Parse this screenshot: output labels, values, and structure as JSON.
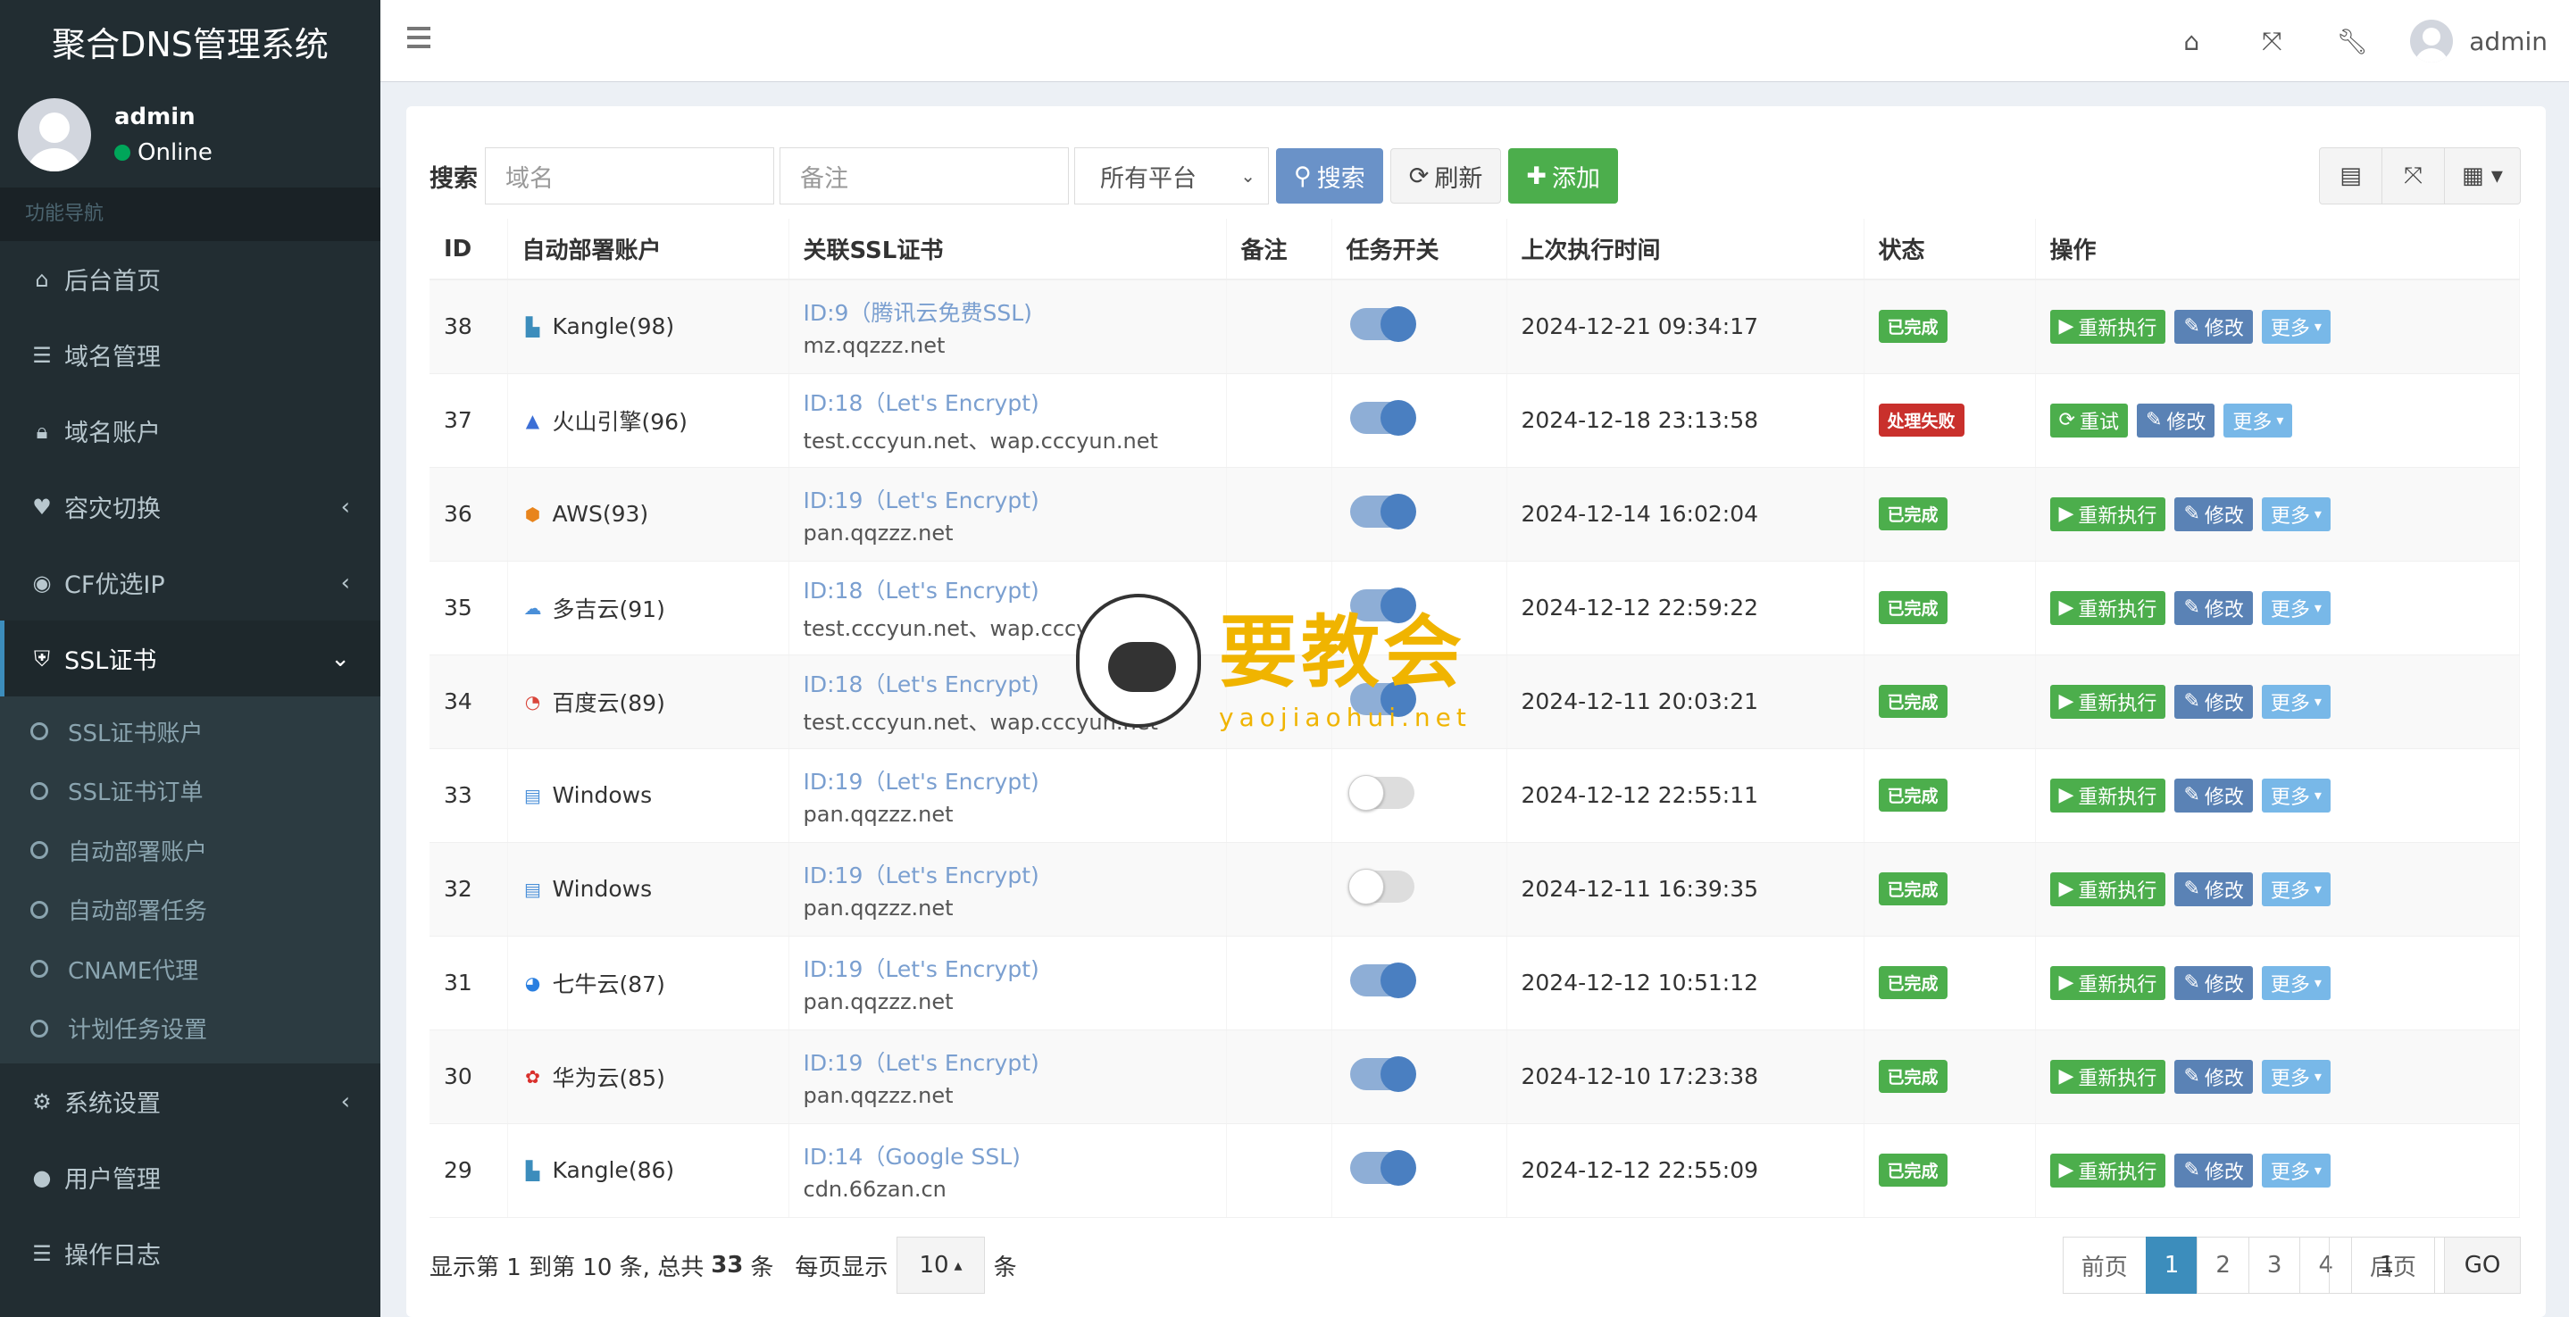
{
  "app": {
    "title": "聚合DNS管理系统"
  },
  "user": {
    "name": "admin",
    "status": "Online"
  },
  "nav": {
    "header": "功能导航",
    "items": [
      {
        "label": "后台首页",
        "icon": "home-icon"
      },
      {
        "label": "域名管理",
        "icon": "list-icon"
      },
      {
        "label": "域名账户",
        "icon": "lock-icon"
      },
      {
        "label": "容灾切换",
        "icon": "heartbeat-icon"
      },
      {
        "label": "CF优选IP",
        "icon": "globe-icon"
      },
      {
        "label": "SSL证书",
        "icon": "certificate-icon"
      }
    ],
    "sub_items": [
      "SSL证书账户",
      "SSL证书订单",
      "自动部署账户",
      "自动部署任务",
      "CNAME代理",
      "计划任务设置"
    ],
    "bottom_items": [
      {
        "label": "系统设置",
        "icon": "cogs-icon"
      },
      {
        "label": "用户管理",
        "icon": "user-icon"
      },
      {
        "label": "操作日志",
        "icon": "list-icon"
      }
    ]
  },
  "header": {
    "admin_label": "admin"
  },
  "toolbar": {
    "search_label": "搜索",
    "domain_placeholder": "域名",
    "remark_placeholder": "备注",
    "platform_selected": "所有平台",
    "search_button": "搜索",
    "refresh_button": "刷新",
    "add_button": "添加"
  },
  "table": {
    "columns": [
      "ID",
      "自动部署账户",
      "关联SSL证书",
      "备注",
      "任务开关",
      "上次执行时间",
      "状态",
      "操作"
    ],
    "rows": [
      {
        "id": "38",
        "account": "Kangle(98)",
        "icon": "kangle-icon",
        "cert": "ID:9（腾讯云免费SSL)",
        "domains": "mz.qqzzz.net",
        "enabled": true,
        "time": "2024-12-21 09:34:17",
        "status": "已完成",
        "ok": true,
        "op1": "重新执行",
        "op2": "修改",
        "op3": "更多"
      },
      {
        "id": "37",
        "account": "火山引擎(96)",
        "icon": "volcengine-icon",
        "cert": "ID:18（Let's Encrypt)",
        "domains": "test.cccyun.net、wap.cccyun.net",
        "enabled": true,
        "time": "2024-12-18 23:13:58",
        "status": "处理失败",
        "ok": false,
        "op1": "重试",
        "op2": "修改",
        "op3": "更多"
      },
      {
        "id": "36",
        "account": "AWS(93)",
        "icon": "aws-icon",
        "cert": "ID:19（Let's Encrypt)",
        "domains": "pan.qqzzz.net",
        "enabled": true,
        "time": "2024-12-14 16:02:04",
        "status": "已完成",
        "ok": true,
        "op1": "重新执行",
        "op2": "修改",
        "op3": "更多"
      },
      {
        "id": "35",
        "account": "多吉云(91)",
        "icon": "cloud-icon",
        "cert": "ID:18（Let's Encrypt)",
        "domains": "test.cccyun.net、wap.cccyun.net",
        "enabled": true,
        "time": "2024-12-12 22:59:22",
        "status": "已完成",
        "ok": true,
        "op1": "重新执行",
        "op2": "修改",
        "op3": "更多"
      },
      {
        "id": "34",
        "account": "百度云(89)",
        "icon": "baidu-cloud-icon",
        "cert": "ID:18（Let's Encrypt)",
        "domains": "test.cccyun.net、wap.cccyun.net",
        "enabled": true,
        "time": "2024-12-11 20:03:21",
        "status": "已完成",
        "ok": true,
        "op1": "重新执行",
        "op2": "修改",
        "op3": "更多"
      },
      {
        "id": "33",
        "account": "Windows",
        "icon": "database-icon",
        "cert": "ID:19（Let's Encrypt)",
        "domains": "pan.qqzzz.net",
        "enabled": false,
        "time": "2024-12-12 22:55:11",
        "status": "已完成",
        "ok": true,
        "op1": "重新执行",
        "op2": "修改",
        "op3": "更多"
      },
      {
        "id": "32",
        "account": "Windows",
        "icon": "database-icon",
        "cert": "ID:19（Let's Encrypt)",
        "domains": "pan.qqzzz.net",
        "enabled": false,
        "time": "2024-12-11 16:39:35",
        "status": "已完成",
        "ok": true,
        "op1": "重新执行",
        "op2": "修改",
        "op3": "更多"
      },
      {
        "id": "31",
        "account": "七牛云(87)",
        "icon": "qiniu-icon",
        "cert": "ID:19（Let's Encrypt)",
        "domains": "pan.qqzzz.net",
        "enabled": true,
        "time": "2024-12-12 10:51:12",
        "status": "已完成",
        "ok": true,
        "op1": "重新执行",
        "op2": "修改",
        "op3": "更多"
      },
      {
        "id": "30",
        "account": "华为云(85)",
        "icon": "huawei-icon",
        "cert": "ID:19（Let's Encrypt)",
        "domains": "pan.qqzzz.net",
        "enabled": true,
        "time": "2024-12-10 17:23:38",
        "status": "已完成",
        "ok": true,
        "op1": "重新执行",
        "op2": "修改",
        "op3": "更多"
      },
      {
        "id": "29",
        "account": "Kangle(86)",
        "icon": "kangle-icon",
        "cert": "ID:14（Google SSL)",
        "domains": "cdn.66zan.cn",
        "enabled": true,
        "time": "2024-12-12 22:55:09",
        "status": "已完成",
        "ok": true,
        "op1": "重新执行",
        "op2": "修改",
        "op3": "更多"
      }
    ]
  },
  "footer": {
    "summary_prefix": "显示第 1 到第 10 条, 总共",
    "total": "33",
    "summary_suffix": "条",
    "per_page_label": "每页显示",
    "per_page_value": "10",
    "per_page_unit": "条"
  },
  "pagination": {
    "prev": "前页",
    "pages": [
      "1",
      "2",
      "3",
      "4"
    ],
    "current": "1",
    "next": "后页",
    "goto_value": "1",
    "go_label": "GO"
  },
  "watermark": {
    "cn": "要教会",
    "en": "yaojiaohui.net"
  },
  "colors": {
    "sidebar": "#222d32",
    "primary": "#3c8dbc",
    "success": "#4cae4c",
    "danger": "#c9302c"
  }
}
